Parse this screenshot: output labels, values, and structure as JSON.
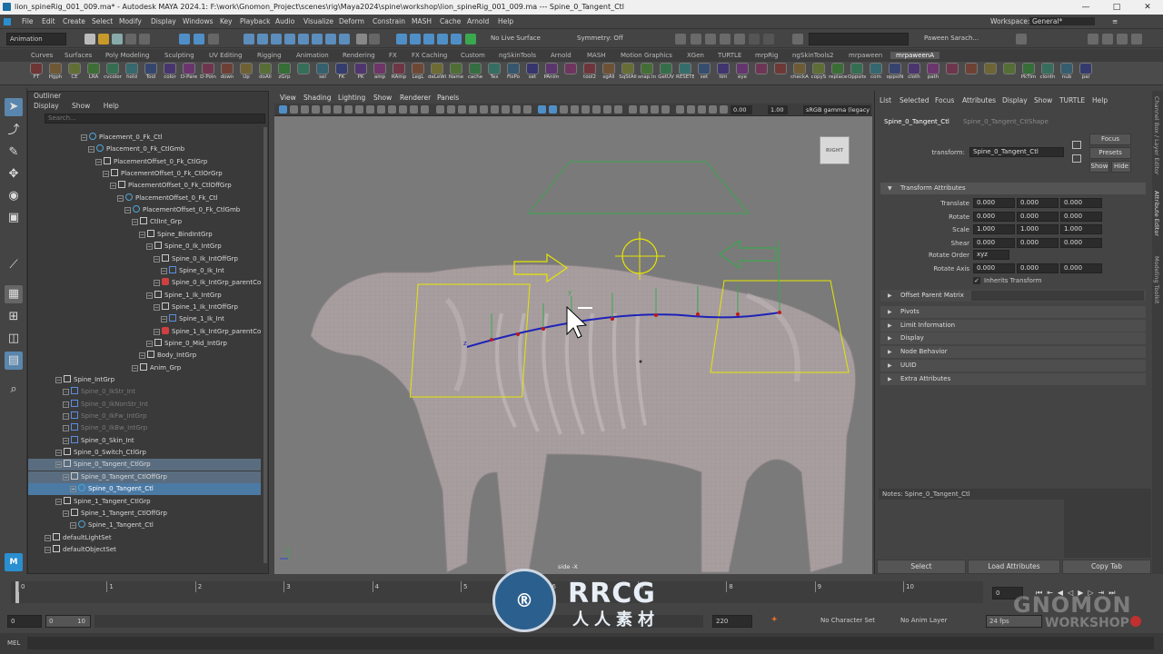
{
  "window": {
    "title": "lion_spineRig_001_009.ma* - Autodesk MAYA 2024.1: F:\\work\\Gnomon_Project\\scenes\\rig\\Maya2024\\spine\\workshop\\lion_spineRig_001_009.ma  ---  Spine_0_Tangent_Ctl",
    "buttons": [
      "—",
      "□",
      "✕"
    ]
  },
  "menubar": {
    "items": [
      "File",
      "Edit",
      "Create",
      "Select",
      "Modify",
      "Display",
      "Windows",
      "Key",
      "Playback",
      "Audio",
      "Visualize",
      "Deform",
      "Constrain",
      "MASH",
      "Cache",
      "Arnold",
      "Help"
    ],
    "workspace_label": "Workspace:",
    "workspace_value": "General*"
  },
  "statusline": {
    "mode": "Animation",
    "live_surface": "No Live Surface",
    "symmetry": "Symmetry: Off",
    "user": "Paween Sarach..."
  },
  "shelf_tabs": [
    "Curves",
    "Surfaces",
    "Poly Modeling",
    "Sculpting",
    "UV Editing",
    "Rigging",
    "Animation",
    "Rendering",
    "FX",
    "FX Caching",
    "Custom",
    "ngSkinTools",
    "Arnold",
    "MASH",
    "Motion Graphics",
    "XGen",
    "TURTLE",
    "mrpRig",
    "ngSkinTools2",
    "mrpaween",
    "mrpaweenA"
  ],
  "shelf_active_tab": "mrpaweenA",
  "shelf_items": [
    "FT",
    "Hgph",
    "CE",
    "LRA",
    "cvcolor",
    "hold",
    "Tool",
    "color",
    "D-Pare",
    "D-Poin",
    "down",
    "Up",
    "doAll",
    "zGrp",
    "",
    "sel",
    "FK",
    "PK",
    "amp",
    "RAmp",
    "LegL",
    "deLeWi",
    "Name",
    "cache",
    "Tex",
    "FixPo",
    "set",
    "PAnim",
    "",
    "tool2",
    "sgAll",
    "SqStAll",
    "snap.Int",
    "GetUV",
    "RESETE",
    "set",
    "tim",
    "eye",
    "",
    "",
    "checkA",
    "copyS",
    "replace",
    "OppsiteN",
    "com",
    "oppsiN",
    "cloth",
    "path",
    "",
    "",
    "",
    "",
    "PkTim",
    "clonth",
    "nub",
    "pai"
  ],
  "outliner": {
    "title": "Outliner",
    "menu": [
      "Display",
      "Show",
      "Help"
    ],
    "search_placeholder": "Search...",
    "rows": [
      {
        "label": "Placement_0_Fk_Ctl",
        "indent": 58,
        "icon": "curve",
        "state": ""
      },
      {
        "label": "Placement_0_Fk_CtlGmb",
        "indent": 66,
        "icon": "curve",
        "state": ""
      },
      {
        "label": "PlacementOffset_0_Fk_CtlGrp",
        "indent": 74,
        "icon": "group",
        "state": ""
      },
      {
        "label": "PlacementOffset_0_Fk_CtlOrGrp",
        "indent": 82,
        "icon": "group",
        "state": ""
      },
      {
        "label": "PlacementOffset_0_Fk_CtlOffGrp",
        "indent": 90,
        "icon": "group",
        "state": ""
      },
      {
        "label": "PlacementOffset_0_Fk_Ctl",
        "indent": 98,
        "icon": "curve",
        "state": ""
      },
      {
        "label": "PlacementOffset_0_Fk_CtlGmb",
        "indent": 106,
        "icon": "curve",
        "state": ""
      },
      {
        "label": "CtlInt_Grp",
        "indent": 114,
        "icon": "group",
        "state": ""
      },
      {
        "label": "Spine_BindIntGrp",
        "indent": 122,
        "icon": "group",
        "state": ""
      },
      {
        "label": "Spine_0_Ik_IntGrp",
        "indent": 130,
        "icon": "group",
        "state": ""
      },
      {
        "label": "Spine_0_Ik_IntOffGrp",
        "indent": 138,
        "icon": "group",
        "state": ""
      },
      {
        "label": "Spine_0_Ik_Int",
        "indent": 146,
        "icon": "joint",
        "state": ""
      },
      {
        "label": "Spine_0_Ik_IntGrp_parentCons",
        "indent": 138,
        "icon": "constraint",
        "state": ""
      },
      {
        "label": "Spine_1_Ik_IntGrp",
        "indent": 130,
        "icon": "group",
        "state": ""
      },
      {
        "label": "Spine_1_Ik_IntOffGrp",
        "indent": 138,
        "icon": "group",
        "state": ""
      },
      {
        "label": "Spine_1_Ik_Int",
        "indent": 146,
        "icon": "joint",
        "state": ""
      },
      {
        "label": "Spine_1_Ik_IntGrp_parentCons",
        "indent": 138,
        "icon": "constraint",
        "state": ""
      },
      {
        "label": "Spine_0_Mid_IntGrp",
        "indent": 130,
        "icon": "group",
        "state": ""
      },
      {
        "label": "Body_IntGrp",
        "indent": 122,
        "icon": "group",
        "state": ""
      },
      {
        "label": "Anim_Grp",
        "indent": 114,
        "icon": "group",
        "state": ""
      },
      {
        "label": "Spine_IntGrp",
        "indent": 30,
        "icon": "group",
        "state": ""
      },
      {
        "label": "Spine_0_IkStr_Int",
        "indent": 38,
        "icon": "joint",
        "state": "dim"
      },
      {
        "label": "Spine_0_IkNonStr_Int",
        "indent": 38,
        "icon": "joint",
        "state": "dim"
      },
      {
        "label": "Spine_0_IkFw_IntGrp",
        "indent": 38,
        "icon": "joint",
        "state": "dim"
      },
      {
        "label": "Spine_0_IkBw_IntGrp",
        "indent": 38,
        "icon": "joint",
        "state": "dim"
      },
      {
        "label": "Spine_0_Skin_Int",
        "indent": 38,
        "icon": "joint",
        "state": ""
      },
      {
        "label": "Spine_0_Switch_CtlGrp",
        "indent": 30,
        "icon": "group",
        "state": ""
      },
      {
        "label": "Spine_0_Tangent_CtlGrp",
        "indent": 30,
        "icon": "group",
        "state": "hl"
      },
      {
        "label": "Spine_0_Tangent_CtlOffGrp",
        "indent": 38,
        "icon": "group",
        "state": "hl"
      },
      {
        "label": "Spine_0_Tangent_Ctl",
        "indent": 46,
        "icon": "curve",
        "state": "sel"
      },
      {
        "label": "Spine_1_Tangent_CtlGrp",
        "indent": 30,
        "icon": "group",
        "state": ""
      },
      {
        "label": "Spine_1_Tangent_CtlOffGrp",
        "indent": 38,
        "icon": "group",
        "state": ""
      },
      {
        "label": "Spine_1_Tangent_Ctl",
        "indent": 46,
        "icon": "curve",
        "state": ""
      },
      {
        "label": "defaultLightSet",
        "indent": 18,
        "icon": "set",
        "state": ""
      },
      {
        "label": "defaultObjectSet",
        "indent": 18,
        "icon": "set",
        "state": ""
      }
    ]
  },
  "viewport": {
    "menu": [
      "View",
      "Shading",
      "Lighting",
      "Show",
      "Renderer",
      "Panels"
    ],
    "field_a": "0.00",
    "field_b": "1.00",
    "color_space": "sRGB gamma (legacy",
    "cube_label": "RIGHT",
    "camera_label": "side -X",
    "axis_y": "y",
    "axis_z": "z"
  },
  "attribute_editor": {
    "menu": [
      "List",
      "Selected",
      "Focus",
      "Attributes",
      "Display",
      "Show",
      "TURTLE",
      "Help"
    ],
    "tab_active": "Spine_0_Tangent_Ctl",
    "tab_other": "Spine_0_Tangent_CtlShape",
    "transform_label": "transform:",
    "transform_value": "Spine_0_Tangent_Ctl",
    "focus_btn": "Focus",
    "presets_btn": "Presets",
    "show_btn": "Show",
    "hide_btn": "Hide",
    "section_transform": "Transform Attributes",
    "rows": [
      {
        "label": "Translate",
        "values": [
          "0.000",
          "0.000",
          "0.000"
        ]
      },
      {
        "label": "Rotate",
        "values": [
          "0.000",
          "0.000",
          "0.000"
        ]
      },
      {
        "label": "Scale",
        "values": [
          "1.000",
          "1.000",
          "1.000"
        ]
      },
      {
        "label": "Shear",
        "values": [
          "0.000",
          "0.000",
          "0.000"
        ]
      }
    ],
    "rotate_order_label": "Rotate Order",
    "rotate_order_value": "xyz",
    "rotate_axis_label": "Rotate Axis",
    "rotate_axis_values": [
      "0.000",
      "0.000",
      "0.000"
    ],
    "inherits_transform": "Inherits Transform",
    "offset_parent_matrix": "Offset Parent Matrix",
    "sections": [
      "Pivots",
      "Limit Information",
      "Display",
      "Node Behavior",
      "UUID",
      "Extra Attributes"
    ],
    "notes_label": "Notes:  Spine_0_Tangent_Ctl",
    "bottom_buttons": [
      "Select",
      "Load Attributes",
      "Copy Tab"
    ]
  },
  "right_strip": [
    "Channel Box / Layer Editor",
    "Attribute Editor",
    "Modeling Toolkit"
  ],
  "timeline": {
    "ticks": [
      "0",
      "1",
      "2",
      "3",
      "4",
      "5",
      "6",
      "7",
      "8",
      "9",
      "10"
    ],
    "current_frame": "0"
  },
  "range": {
    "start": "0",
    "inner_start": "0",
    "inner_end": "10",
    "end": "220",
    "character_set": "No Character Set",
    "anim_layer": "No Anim Layer",
    "fps": "24 fps"
  },
  "cmdline": {
    "label": "MEL"
  },
  "watermarks": {
    "logo_text": "RRCG",
    "logo_sub": "人人素材",
    "right_mark": "GNOMON",
    "right_sub": "WORKSHOP"
  },
  "colors": {
    "selection": "#4b7aa5",
    "highlight": "#5a6d80",
    "control_yellow": "#e6e600",
    "control_green": "#3aa84e",
    "spine_blue": "#1e22b8",
    "viewport_bg": "#7a7a7a"
  }
}
